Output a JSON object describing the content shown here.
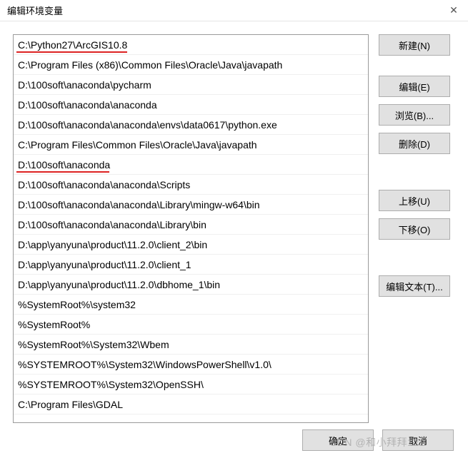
{
  "window": {
    "title": "编辑环境变量",
    "close_icon": "✕"
  },
  "list": [
    {
      "text": "C:\\Python27\\ArcGIS10.8",
      "underlined": true,
      "width": "ul-w155"
    },
    {
      "text": "C:\\Program Files (x86)\\Common Files\\Oracle\\Java\\javapath"
    },
    {
      "text": "D:\\100soft\\anaconda\\pycharm"
    },
    {
      "text": "D:\\100soft\\anaconda\\anaconda"
    },
    {
      "text": "D:\\100soft\\anaconda\\anaconda\\envs\\data0617\\python.exe"
    },
    {
      "text": "C:\\Program Files\\Common Files\\Oracle\\Java\\javapath"
    },
    {
      "text": "D:\\100soft\\anaconda",
      "underlined": true,
      "width": "ul-w130"
    },
    {
      "text": "D:\\100soft\\anaconda\\anaconda\\Scripts"
    },
    {
      "text": "D:\\100soft\\anaconda\\anaconda\\Library\\mingw-w64\\bin"
    },
    {
      "text": "D:\\100soft\\anaconda\\anaconda\\Library\\bin"
    },
    {
      "text": "D:\\app\\yanyuna\\product\\11.2.0\\client_2\\bin"
    },
    {
      "text": "D:\\app\\yanyuna\\product\\11.2.0\\client_1"
    },
    {
      "text": "D:\\app\\yanyuna\\product\\11.2.0\\dbhome_1\\bin"
    },
    {
      "text": "%SystemRoot%\\system32"
    },
    {
      "text": "%SystemRoot%"
    },
    {
      "text": "%SystemRoot%\\System32\\Wbem"
    },
    {
      "text": "%SYSTEMROOT%\\System32\\WindowsPowerShell\\v1.0\\"
    },
    {
      "text": "%SYSTEMROOT%\\System32\\OpenSSH\\"
    },
    {
      "text": "C:\\Program Files\\GDAL"
    }
  ],
  "buttons": {
    "new": "新建(N)",
    "edit": "编辑(E)",
    "browse": "浏览(B)...",
    "delete": "删除(D)",
    "moveup": "上移(U)",
    "movedown": "下移(O)",
    "edittext": "编辑文本(T)..."
  },
  "footer": {
    "ok": "确定",
    "cancel": "取消"
  },
  "watermark": "SDN @和小拜拜122"
}
